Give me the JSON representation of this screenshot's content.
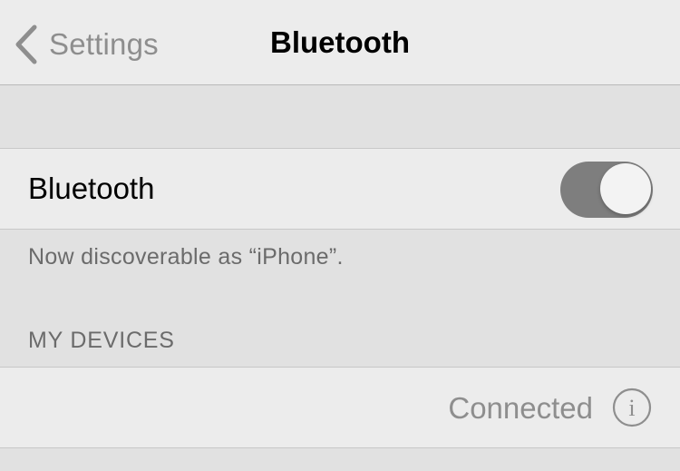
{
  "nav": {
    "back_label": "Settings",
    "title": "Bluetooth"
  },
  "bluetooth_row": {
    "label": "Bluetooth",
    "toggle_on": true
  },
  "discoverable_text": "Now discoverable as “iPhone”.",
  "devices_section": {
    "header": "MY DEVICES",
    "devices": [
      {
        "name": "",
        "status": "Connected",
        "info_icon": "info-circle-icon"
      }
    ]
  },
  "colors": {
    "toggle_on_track": "#7e7e7e",
    "secondary_text": "#8e8e8e",
    "background": "#e1e1e1"
  }
}
